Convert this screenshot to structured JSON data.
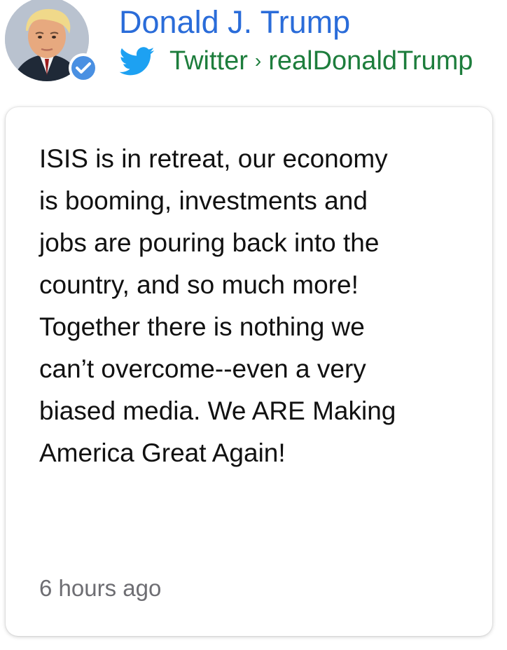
{
  "author": {
    "name": "Donald J. Trump",
    "avatar_icon": "profile-photo",
    "verified_icon": "verified-check-icon"
  },
  "source": {
    "platform": "Twitter",
    "separator": "›",
    "handle": "realDonaldTrump",
    "icon": "twitter-bird-icon"
  },
  "tweet": {
    "lines": [
      "ISIS is in retreat, our economy",
      "is booming, investments and",
      "jobs are pouring back into the",
      "country, and so much more!",
      "Together there is nothing we",
      "can’t overcome--even a very",
      "biased media. We ARE Making",
      "America Great Again!"
    ],
    "timestamp": "6 hours ago"
  },
  "colors": {
    "name": "#2a6cd9",
    "source": "#1d7d3c",
    "twitter_blue": "#1da1f2",
    "verified_blue": "#4a90e2",
    "body_text": "#111111",
    "timestamp": "#6e6e73"
  }
}
